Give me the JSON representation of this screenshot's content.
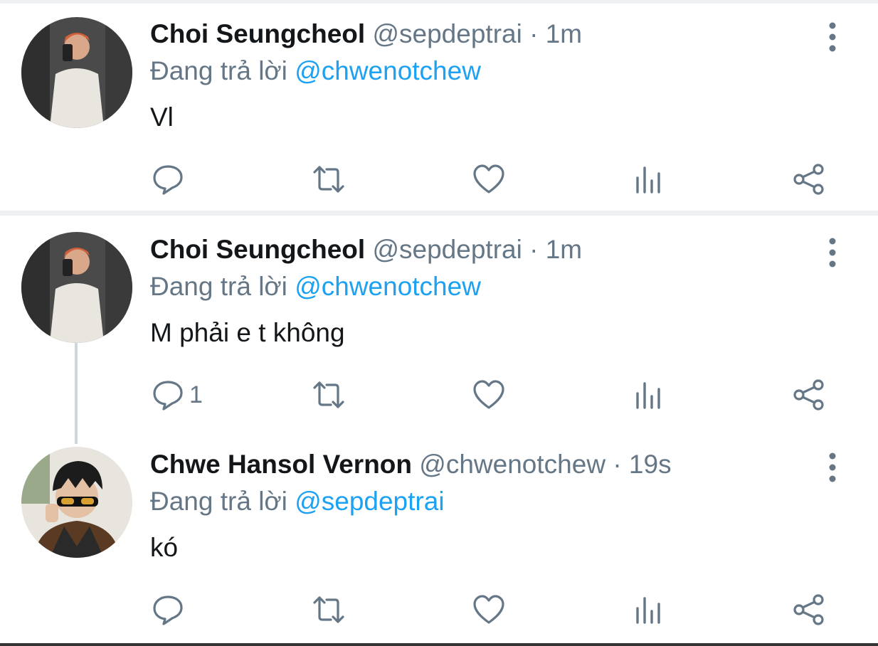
{
  "tweets": [
    {
      "name": "Choi Seungcheol",
      "handle": "@sepdeptrai · 1m",
      "replying_prefix": "Đang trả lời ",
      "replying_to": "@chwenotchew",
      "text": "Vl",
      "reply_count": ""
    },
    {
      "name": "Choi Seungcheol",
      "handle": "@sepdeptrai · 1m",
      "replying_prefix": "Đang trả lời ",
      "replying_to": "@chwenotchew",
      "text": "M phải e t không",
      "reply_count": "1"
    },
    {
      "name": "Chwe Hansol Vernon",
      "handle": "@chwenotchew · 19s",
      "replying_prefix": "Đang trả lời ",
      "replying_to": "@sepdeptrai",
      "text": "kó",
      "reply_count": ""
    }
  ],
  "icons": {
    "reply": "reply-bubble-icon",
    "retweet": "retweet-icon",
    "like": "heart-icon",
    "stats": "analytics-icon",
    "share": "share-icon",
    "more": "more-vertical-icon"
  },
  "colors": {
    "accent": "#1da1f2",
    "icon": "#657786",
    "text": "#14171a"
  }
}
